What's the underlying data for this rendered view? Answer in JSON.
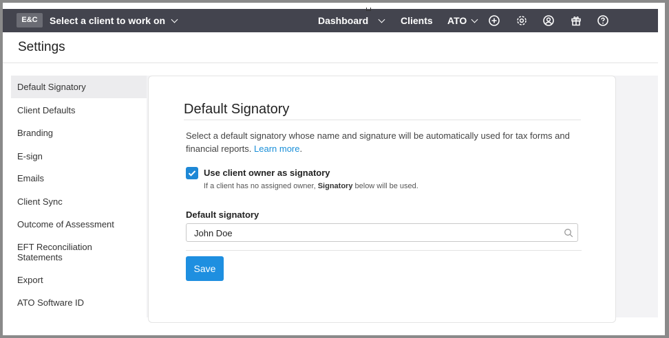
{
  "topbar": {
    "logo": "E&C",
    "client_select": "Select a client to work on",
    "nav": {
      "dashboard": "Dashboard",
      "clients": "Clients",
      "ato": "ATO"
    },
    "icons": [
      "plus-circle-icon",
      "gear-icon",
      "user-circle-icon",
      "gift-icon",
      "help-circle-icon"
    ]
  },
  "page": {
    "title": "Settings"
  },
  "sidebar": {
    "items": [
      {
        "label": "Default Signatory",
        "active": true
      },
      {
        "label": "Client Defaults"
      },
      {
        "label": "Branding"
      },
      {
        "label": "E-sign"
      },
      {
        "label": "Emails"
      },
      {
        "label": "Client Sync"
      },
      {
        "label": "Outcome of Assessment"
      },
      {
        "label": "EFT Reconciliation Statements"
      },
      {
        "label": "Export"
      },
      {
        "label": "ATO Software ID"
      }
    ]
  },
  "main": {
    "section_title": "Default Signatory",
    "description": "Select a default signatory whose name and signature will be automatically used for tax forms and financial reports.",
    "learn_more": "Learn more",
    "checkbox": {
      "label": "Use client owner as signatory",
      "checked": true,
      "help_prefix": "If a client has no assigned owner, ",
      "help_bold": "Signatory",
      "help_suffix": " below will be used."
    },
    "field": {
      "label": "Default signatory",
      "value": "John Doe"
    },
    "save_label": "Save"
  },
  "colors": {
    "topbar": "#43444e",
    "accent": "#1e8fe0",
    "checkbox": "#1e88d6",
    "link": "#1a8fd8"
  }
}
